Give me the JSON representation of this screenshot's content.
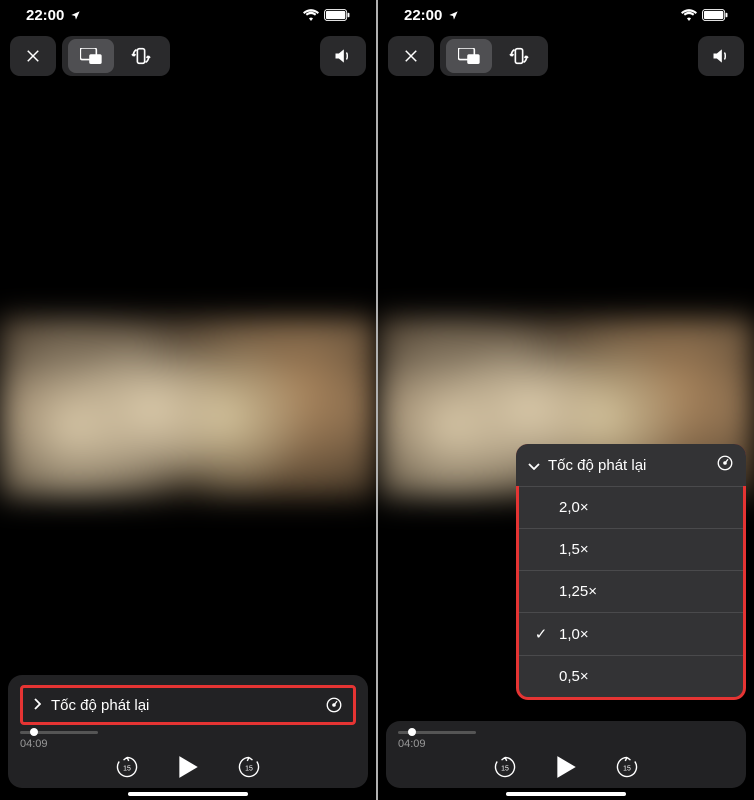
{
  "status": {
    "time": "22:00"
  },
  "player": {
    "position_label": "04:09",
    "speed": {
      "label": "Tốc độ phát lại",
      "options": [
        "2,0×",
        "1,5×",
        "1,25×",
        "1,0×",
        "0,5×"
      ],
      "selected": "1,0×"
    }
  }
}
